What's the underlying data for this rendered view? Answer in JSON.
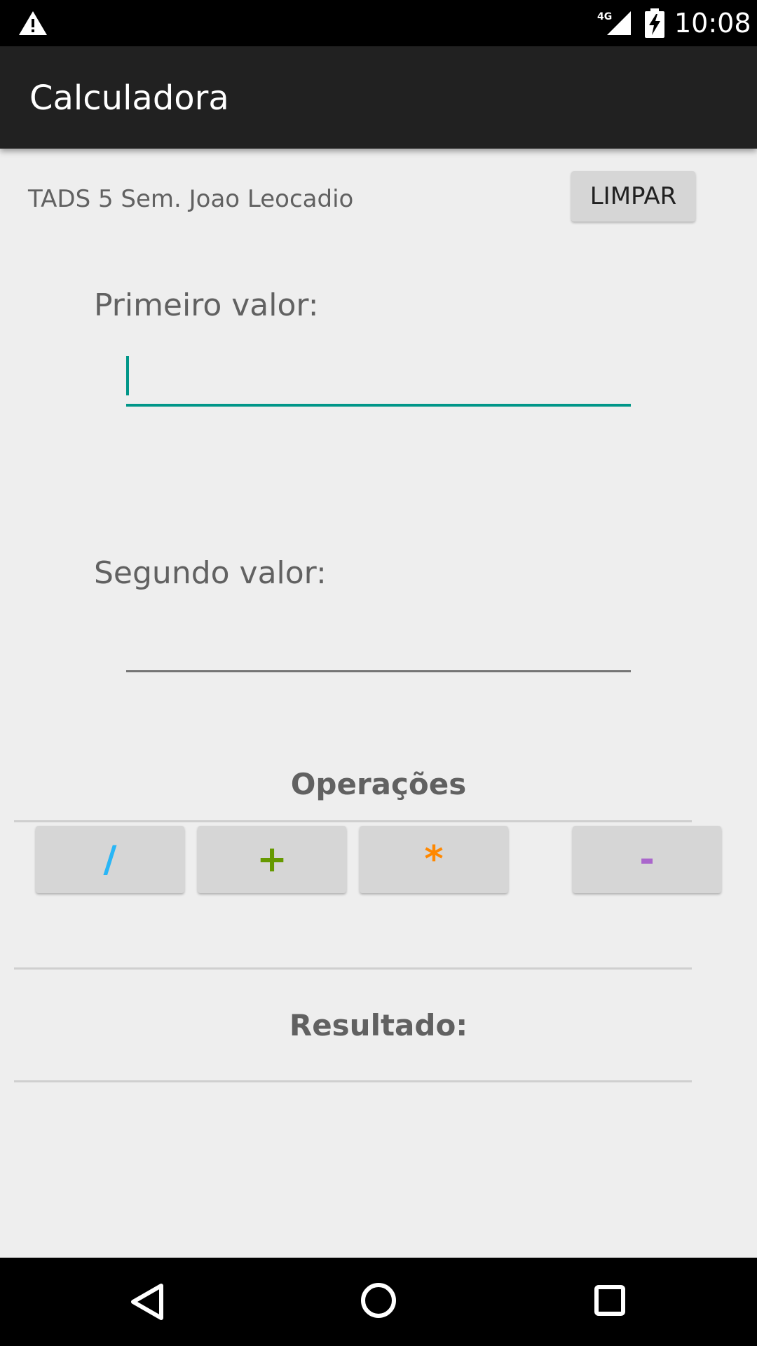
{
  "status_bar": {
    "time": "10:08",
    "network": "4G",
    "icons": [
      "warning-icon",
      "cell-signal-icon",
      "battery-charging-icon"
    ]
  },
  "app_bar": {
    "title": "Calculadora"
  },
  "header": {
    "author": "TADS 5 Sem. Joao Leocadio",
    "clear_label": "LIMPAR"
  },
  "form": {
    "first_label": "Primeiro valor:",
    "first_value": "",
    "second_label": "Segundo valor:",
    "second_value": ""
  },
  "operations": {
    "title": "Operações",
    "buttons": [
      {
        "label": "/",
        "color": "#29b6f6"
      },
      {
        "label": "+",
        "color": "#669900"
      },
      {
        "label": "*",
        "color": "#ff8800"
      },
      {
        "label": "-",
        "color": "#aa66cc"
      }
    ]
  },
  "result": {
    "title": "Resultado:"
  },
  "colors": {
    "accent": "#009688",
    "app_bar": "#212121",
    "background": "#eeeeee"
  },
  "nav_bar": {
    "icons": [
      "back-icon",
      "home-icon",
      "recents-icon"
    ]
  }
}
